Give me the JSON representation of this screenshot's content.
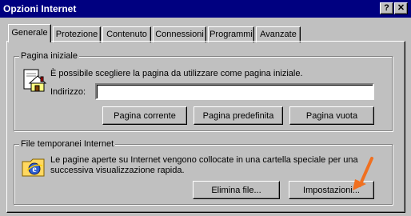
{
  "window": {
    "title": "Opzioni Internet",
    "help_icon": "question-mark-icon",
    "close_icon": "close-icon",
    "help_glyph": "?",
    "close_glyph": "✕"
  },
  "tabs": [
    {
      "label": "Generale",
      "active": true
    },
    {
      "label": "Protezione",
      "active": false
    },
    {
      "label": "Contenuto",
      "active": false
    },
    {
      "label": "Connessioni",
      "active": false
    },
    {
      "label": "Programmi",
      "active": false
    },
    {
      "label": "Avanzate",
      "active": false
    }
  ],
  "home_page": {
    "legend": "Pagina iniziale",
    "icon": "home-page-icon",
    "description": "È possibile scegliere la pagina da utilizzare come pagina iniziale.",
    "address_label": "Indirizzo:",
    "address_value": "",
    "buttons": {
      "current": "Pagina corrente",
      "default": "Pagina predefinita",
      "blank": "Pagina vuota"
    }
  },
  "temp_files": {
    "legend": "File temporanei Internet",
    "icon": "internet-explorer-icon",
    "description_line1": "Le pagine aperte su Internet vengono collocate in una cartella speciale per una",
    "description_line2": "successiva visualizzazione rapida.",
    "buttons": {
      "delete": "Elimina file...",
      "settings": "Impostazioni..."
    }
  },
  "annotation": {
    "icon": "orange-arrow-icon",
    "color": "#f07020"
  },
  "colors": {
    "titlebar": "#000080",
    "face": "#c0c0c0"
  }
}
